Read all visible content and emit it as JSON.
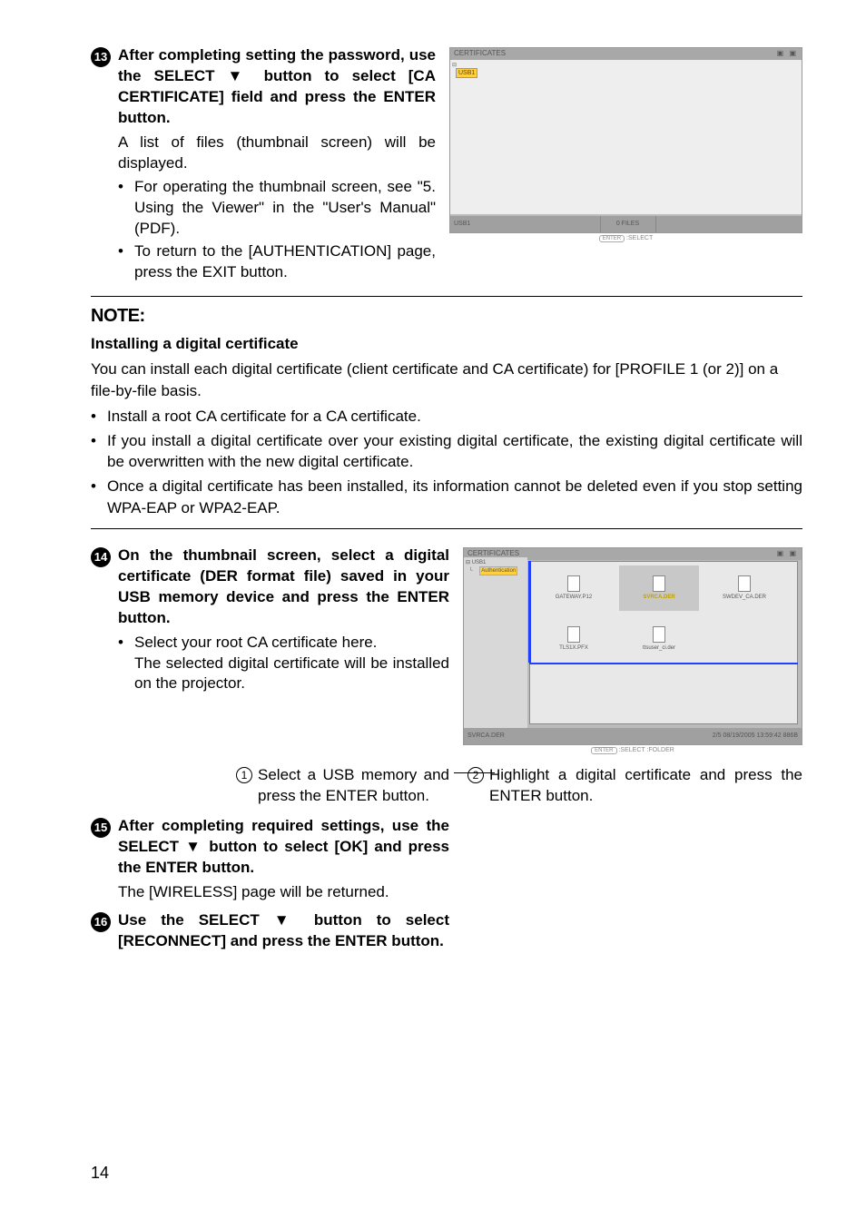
{
  "step13": {
    "num": "⓭",
    "title": "After completing setting the password, use the SELECT ▼ button to select [CA CERTIFICATE] field and press the ENTER button.",
    "body": "A list of files (thumbnail screen) will be displayed.",
    "bullet1": "For operating the thumbnail screen, see \"5. Using the Viewer\" in the \"User's Manual\" (PDF).",
    "bullet2": "To return to the [AUTHENTICATION] page, press the EXIT button."
  },
  "thumb1": {
    "header": "CERTIFICATES",
    "chip": "USB1",
    "footer_left": "USB1",
    "footer_center": "0 FILES",
    "select": ":SELECT"
  },
  "note": {
    "title": "NOTE:",
    "subtitle": "Installing a digital certificate",
    "intro": "You can install each digital certificate (client certificate and CA certificate) for [PROFILE 1 (or 2)] on a file-by-file basis.",
    "b1": "Install a root CA certificate for a CA certificate.",
    "b2": "If you install a digital certificate over your existing digital certificate, the existing digital certificate will be overwritten with the new digital certificate.",
    "b3": "Once a digital certificate has been installed, its information cannot be deleted even if you stop setting WPA-EAP or WPA2-EAP."
  },
  "step14": {
    "num": "⓮",
    "title": "On the thumbnail screen, select a digital certificate (DER format file) saved in your USB memory device and press the ENTER button.",
    "bullet": "Select your root CA certificate here.",
    "bullet_sub": "The selected digital certificate will be installed on the projector."
  },
  "thumb2": {
    "header": "CERTIFICATES",
    "side_usb": "USB1",
    "side_auth": "Authentication",
    "files": [
      "GATEWAY.P12",
      "SVRCA.DER",
      "SWDEV_CA.DER",
      "TLS1X.PFX",
      "ttsuser_ci.der"
    ],
    "footer_left": "SVRCA.DER",
    "footer_right": "2/5    08/19/2005 13:59:42   886B",
    "select": ":SELECT      :FOLDER"
  },
  "callout1": "Select a USB memory and press the ENTER button.",
  "callout2": "Highlight a digital certificate and press the ENTER button.",
  "step15": {
    "num": "⓯",
    "title": "After completing required settings, use the SELECT ▼ button to select [OK] and press the ENTER button.",
    "body": "The [WIRELESS] page will be returned."
  },
  "step16": {
    "num": "⓰",
    "title": "Use the SELECT ▼ button to select [RECONNECT] and press the ENTER button."
  },
  "page": "14"
}
